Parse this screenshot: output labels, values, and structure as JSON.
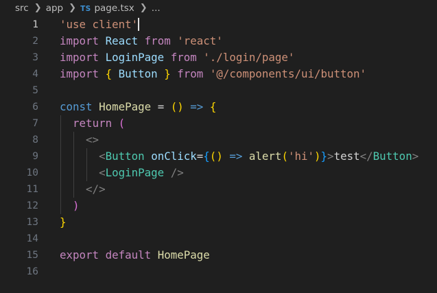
{
  "breadcrumb": {
    "items": [
      {
        "label": "src"
      },
      {
        "label": "app"
      },
      {
        "icon_text": "TS",
        "label": "page.tsx"
      },
      {
        "label": "..."
      }
    ]
  },
  "editor": {
    "active_line": 1,
    "lines": [
      {
        "number": "1"
      },
      {
        "number": "2"
      },
      {
        "number": "3"
      },
      {
        "number": "4"
      },
      {
        "number": "5"
      },
      {
        "number": "6"
      },
      {
        "number": "7"
      },
      {
        "number": "8"
      },
      {
        "number": "9"
      },
      {
        "number": "10"
      },
      {
        "number": "11"
      },
      {
        "number": "12"
      },
      {
        "number": "13"
      },
      {
        "number": "14"
      },
      {
        "number": "15"
      },
      {
        "number": "16"
      }
    ],
    "tokens": {
      "l1_str": "'use client'",
      "import": "import",
      "from": "from",
      "react_id": "React",
      "react_str": "'react'",
      "login_id": "LoginPage",
      "login_str": "'./login/page'",
      "brace_open": "{",
      "brace_close": "}",
      "button_id": "Button",
      "button_str": "'@/components/ui/button'",
      "const": "const",
      "homepage": "HomePage",
      "equals": "=",
      "paren_pair_open": "(",
      "paren_pair_close": ")",
      "arrow": "=>",
      "return": "return",
      "frag_open": "<>",
      "frag_close": "</>",
      "lt": "<",
      "gt": ">",
      "lt_slash": "</",
      "self_close": "/>",
      "onclick": "onClick",
      "alert": "alert",
      "hi_str": "'hi'",
      "test_text": "test",
      "export": "export",
      "default": "default"
    }
  },
  "colors": {
    "background": "#1f1f1f",
    "keyword": "#c586c0",
    "string": "#ce9178",
    "identifier": "#9cdcfe",
    "function": "#dcdcaa",
    "component": "#4ec9b0",
    "bracket_gold": "#ffd700",
    "bracket_magenta": "#da70d6",
    "bracket_blue": "#179fff",
    "storage": "#569cd6"
  }
}
